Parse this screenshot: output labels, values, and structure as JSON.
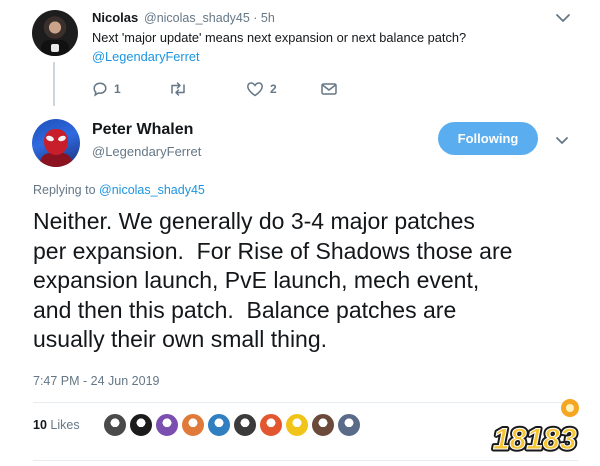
{
  "parent_tweet": {
    "name": "Nicolas",
    "handle": "@nicolas_shady45",
    "time": "· 5h",
    "text": "Next 'major update' means next expansion or next balance patch?",
    "mention": "@LegendaryFerret",
    "actions": {
      "reply_count": "1",
      "retweet_count": "",
      "like_count": "2"
    },
    "icons": [
      "reply-icon",
      "retweet-icon",
      "heart-icon",
      "message-icon",
      "chevron-down-icon"
    ]
  },
  "main_tweet": {
    "name": "Peter Whalen",
    "handle": "@LegendaryFerret",
    "follow_label": "Following",
    "replying_prefix": "Replying to",
    "replying_to": "@nicolas_shady45",
    "text": "Neither. We generally do 3-4 major patches\nper expansion.  For Rise of Shadows those are\nexpansion launch, PvE launch, mech event,\nand then this patch.  Balance patches are\nusually their own small thing.",
    "timestamp": "7:47 PM - 24 Jun 2019",
    "likes_count": "10",
    "likes_label": "Likes",
    "liker_colors": [
      "#4a4a4a",
      "#1b1b1b",
      "#7a4fb0",
      "#e07a3a",
      "#2f7fc1",
      "#3b3b3b",
      "#e2572f",
      "#f0c419",
      "#6b4a3a",
      "#5a6b8a"
    ]
  },
  "watermark": {
    "text": "18183"
  },
  "colors": {
    "accent": "#1b95e0",
    "button": "#5aaef0",
    "muted": "#657786"
  }
}
